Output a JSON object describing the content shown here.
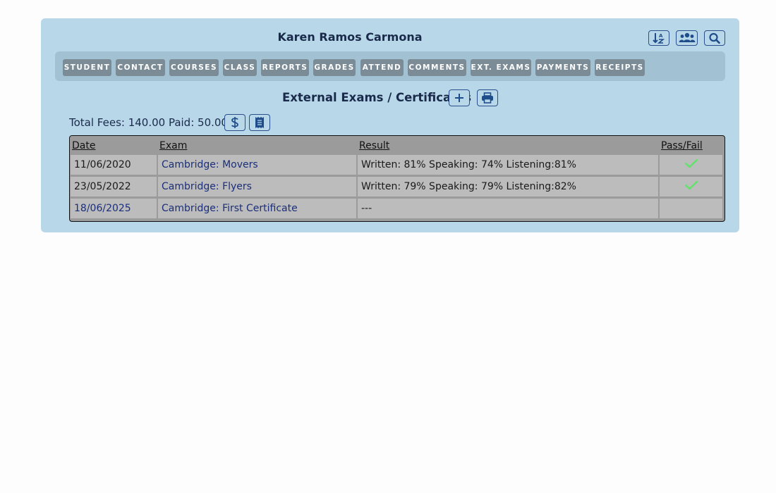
{
  "header": {
    "student_name": "Karen Ramos Carmona",
    "icons": [
      "sort-icon",
      "group-icon",
      "search-icon"
    ]
  },
  "tabs": [
    {
      "label": "STUDENT"
    },
    {
      "label": "CONTACT"
    },
    {
      "label": "COURSES"
    },
    {
      "label": "CLASS"
    },
    {
      "label": "REPORTS"
    },
    {
      "label": "GRADES"
    },
    {
      "label": "ATTEND"
    },
    {
      "label": "COMMENTS"
    },
    {
      "label": "EXT. EXAMS"
    },
    {
      "label": "PAYMENTS"
    },
    {
      "label": "RECEIPTS"
    }
  ],
  "section": {
    "title": "External Exams / Certificates",
    "icons": [
      "plus-icon",
      "print-icon"
    ]
  },
  "fees": {
    "text": "Total Fees: 140.00 Paid: 50.00",
    "icons": [
      "dollar-icon",
      "receipt-icon"
    ]
  },
  "table": {
    "columns": [
      "Date",
      "Exam",
      "Result",
      "Pass/Fail"
    ],
    "rows": [
      {
        "date": "11/06/2020",
        "exam": "Cambridge: Movers",
        "result": "Written: 81% Speaking: 74% Listening:81%",
        "pass": true
      },
      {
        "date": "23/05/2022",
        "exam": "Cambridge: Flyers",
        "result": "Written: 79% Speaking: 79% Listening:82%",
        "pass": true
      },
      {
        "date": "18/06/2025",
        "exam": "Cambridge: First Certificate",
        "result": "---",
        "pass": null
      }
    ]
  },
  "colors": {
    "panel": "#b8d8ea",
    "tabbar": "#a2c2d4",
    "tab": "#7b8c97",
    "accent": "#2a4f8a",
    "check": "#5fe36a"
  }
}
